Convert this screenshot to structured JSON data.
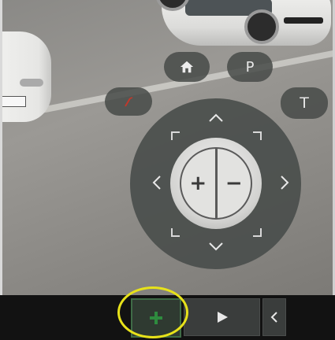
{
  "ptz_controls": {
    "home_icon": "home-icon",
    "preset_label": "P",
    "tour_label": "T",
    "focus_icon": "focus-wand-icon",
    "arrow_up": "^",
    "arrow_down": "v",
    "arrow_left": "<",
    "arrow_right": ">",
    "zoom_in_label": "+",
    "zoom_out_label": "−"
  },
  "toolbar": {
    "add_icon": "plus-icon",
    "play_icon": "play-icon",
    "collapse_icon": "chevron-left-icon",
    "collapse_label": "<"
  },
  "colors": {
    "add_accent": "#2e8b3e",
    "highlight": "#e7e21a",
    "focus_accent": "#c0392b"
  }
}
